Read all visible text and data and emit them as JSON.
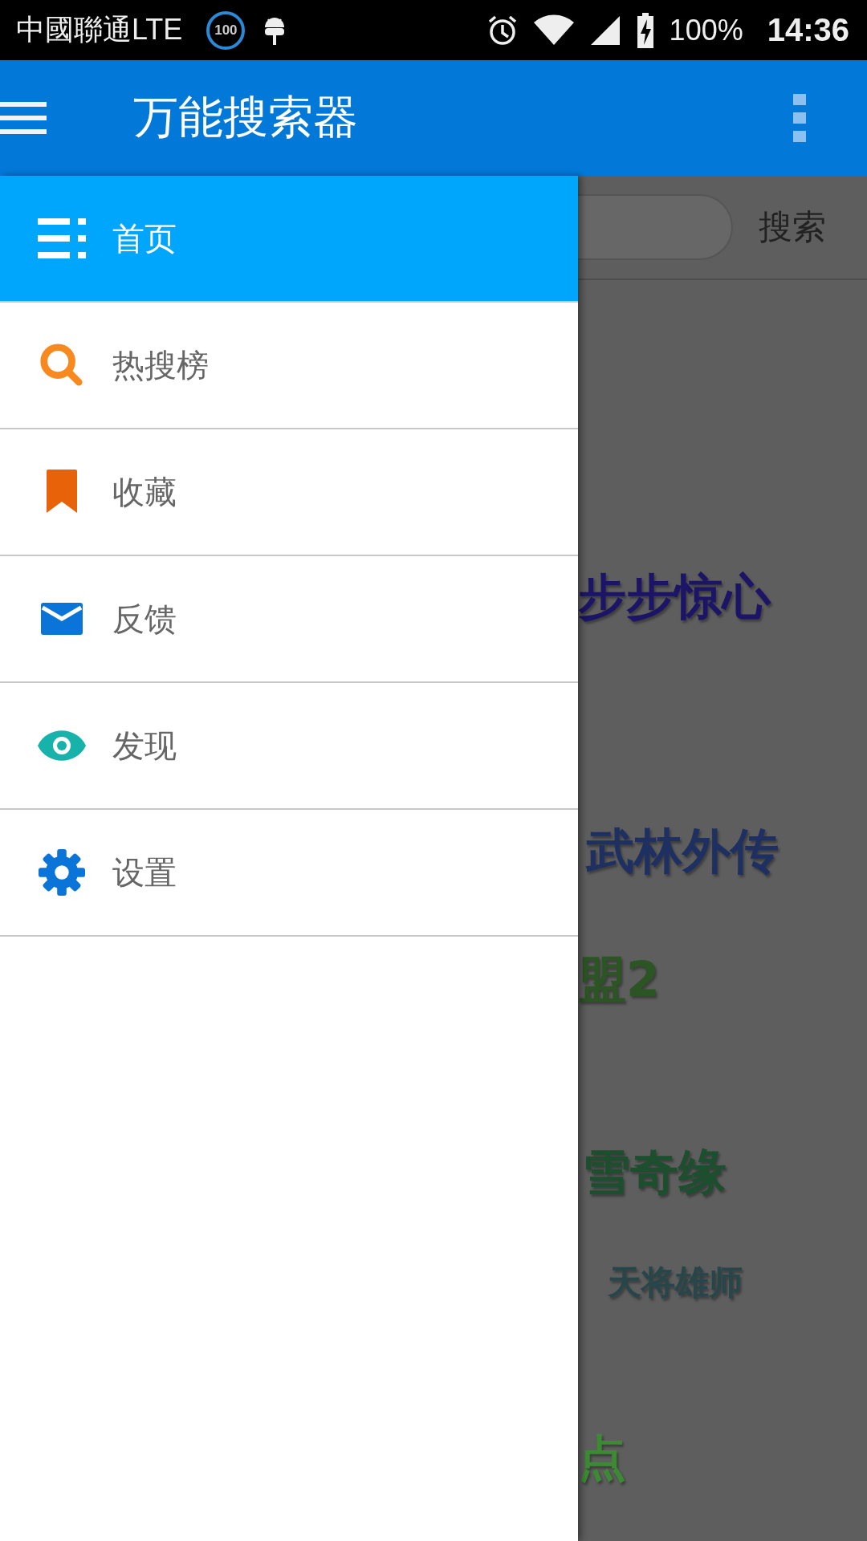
{
  "status_bar": {
    "carrier": "中國聯通LTE",
    "badge": "100",
    "battery": "100%",
    "time": "14:36"
  },
  "app_bar": {
    "title": "万能搜索器"
  },
  "drawer": {
    "items": [
      {
        "label": "首页",
        "selected": true
      },
      {
        "label": "热搜榜",
        "selected": false
      },
      {
        "label": "收藏",
        "selected": false
      },
      {
        "label": "反馈",
        "selected": false
      },
      {
        "label": "发现",
        "selected": false
      },
      {
        "label": "设置",
        "selected": false
      }
    ]
  },
  "search": {
    "button": "搜索"
  },
  "hot_words": [
    {
      "text": "步步惊心",
      "color": "#1c1466"
    },
    {
      "text": "武林外传",
      "color": "#1e2f62"
    },
    {
      "text": "盟2",
      "color": "#2b5522"
    },
    {
      "text": "雪奇缘",
      "color": "#1b4f2e"
    },
    {
      "text": "天将雄师",
      "color": "#27464a"
    },
    {
      "text": "点",
      "color": "#3d8a34"
    }
  ]
}
